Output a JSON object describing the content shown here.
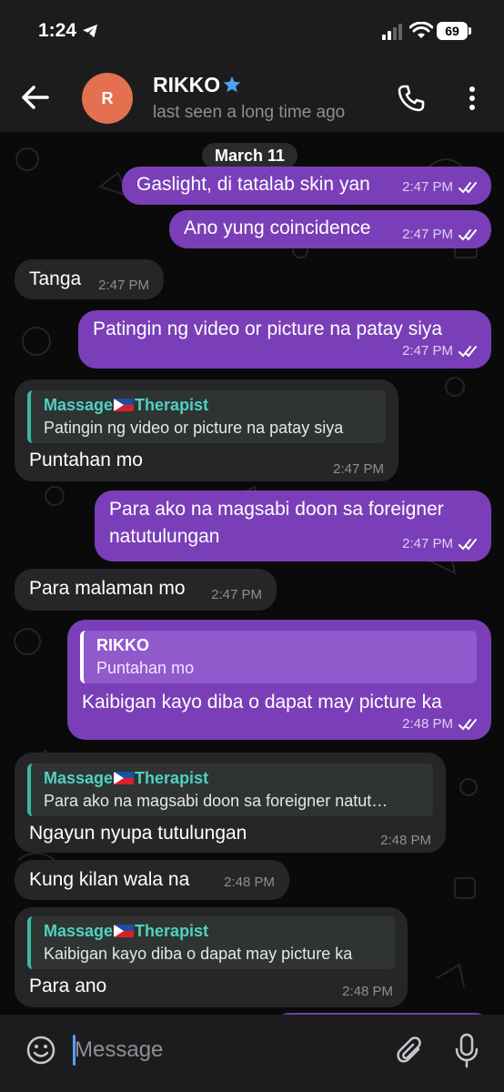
{
  "status_bar": {
    "time": "1:24",
    "battery": "69"
  },
  "header": {
    "avatar_initial": "R",
    "name": "RIKKO",
    "status": "last seen a long time ago"
  },
  "chat": {
    "date": "March 11",
    "messages": [
      {
        "dir": "out",
        "text": "Gaslight, di tatalab skin yan",
        "time": "2:47 PM"
      },
      {
        "dir": "out",
        "text": "Ano yung coincidence",
        "time": "2:47 PM"
      },
      {
        "dir": "in",
        "text": "Tanga",
        "time": "2:47 PM"
      },
      {
        "dir": "out",
        "text": "Patingin ng video or picture na patay siya",
        "time": "2:47 PM"
      },
      {
        "dir": "in",
        "reply_name_a": "Massage",
        "reply_name_b": "Therapist",
        "reply_text": "Patingin ng video or picture na patay siya",
        "text": "Puntahan mo",
        "time": "2:47 PM"
      },
      {
        "dir": "out",
        "text_line1": "Para ako na magsabi doon sa foreigner",
        "text_line2": "natutulungan",
        "time": "2:47 PM"
      },
      {
        "dir": "in",
        "text": "Para malaman mo",
        "time": "2:47 PM"
      },
      {
        "dir": "out",
        "reply_name": "RIKKO",
        "reply_text": "Puntahan mo",
        "text": "Kaibigan kayo diba o dapat may picture ka",
        "time": "2:48 PM"
      },
      {
        "dir": "in",
        "reply_name_a": "Massage",
        "reply_name_b": "Therapist",
        "reply_text": "Para ako na magsabi doon sa foreigner natut…",
        "text": "Ngayun nyupa tutulungan",
        "time": "2:48 PM"
      },
      {
        "dir": "in",
        "text": "Kung kilan  wala na",
        "time": "2:48 PM"
      },
      {
        "dir": "in",
        "reply_name_a": "Massage",
        "reply_name_b": "Therapist",
        "reply_text": "Kaibigan kayo diba o dapat may picture ka",
        "text": "Para ano",
        "time": "2:48 PM"
      }
    ]
  },
  "composer": {
    "placeholder": "Message"
  },
  "colors": {
    "outgoing_bubble": "#7a3fb8",
    "incoming_bubble": "#262628",
    "reply_accent": "#3bb6a8",
    "avatar": "#e4704f",
    "verified_star": "#4ba3f5"
  },
  "icons": [
    "telegram-icon",
    "signal-icon",
    "wifi-icon",
    "back-arrow-icon",
    "star-icon",
    "phone-icon",
    "more-vert-icon",
    "double-check-icon",
    "emoji-icon",
    "paperclip-icon",
    "mic-icon"
  ]
}
